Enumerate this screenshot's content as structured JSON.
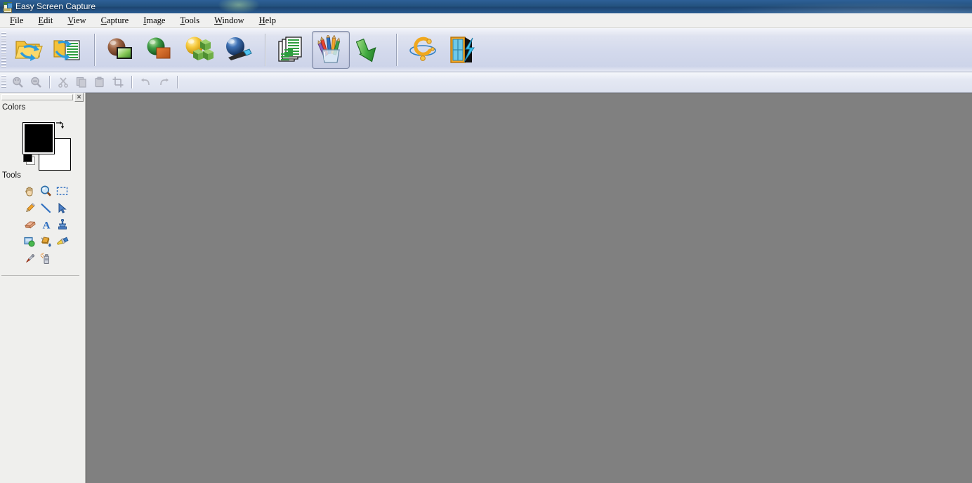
{
  "window": {
    "title": "Easy Screen Capture",
    "icon": "app-document-icon"
  },
  "menubar": {
    "items": [
      {
        "label": "File",
        "accel": "F",
        "name": "menu-file"
      },
      {
        "label": "Edit",
        "accel": "E",
        "name": "menu-edit"
      },
      {
        "label": "View",
        "accel": "V",
        "name": "menu-view"
      },
      {
        "label": "Capture",
        "accel": "C",
        "name": "menu-capture"
      },
      {
        "label": "Image",
        "accel": "I",
        "name": "menu-image"
      },
      {
        "label": "Tools",
        "accel": "T",
        "name": "menu-tools"
      },
      {
        "label": "Window",
        "accel": "W",
        "name": "menu-window"
      },
      {
        "label": "Help",
        "accel": "H",
        "name": "menu-help"
      }
    ]
  },
  "toolbar_main": {
    "buttons": [
      {
        "name": "open-file-button",
        "icon": "folder-open-arrow-icon",
        "active": false
      },
      {
        "name": "open-recent-button",
        "icon": "folder-document-refresh-icon",
        "active": false
      },
      {
        "name": "capture-region-button",
        "icon": "sphere-rectangle-icon",
        "active": false
      },
      {
        "name": "capture-object-button",
        "icon": "sphere-square-icon",
        "active": false
      },
      {
        "name": "capture-objects-button",
        "icon": "sphere-cubes-icon",
        "active": false
      },
      {
        "name": "capture-cursor-button",
        "icon": "sphere-wand-icon",
        "active": false
      },
      {
        "name": "capture-pages-button",
        "icon": "stacked-documents-icon",
        "active": false
      },
      {
        "name": "drawing-tools-button",
        "icon": "pencil-cup-icon",
        "active": true
      },
      {
        "name": "capture-scroll-button",
        "icon": "green-down-arrow-icon",
        "active": false
      },
      {
        "name": "settings-button",
        "icon": "orb-orbit-icon",
        "active": false
      },
      {
        "name": "exit-button",
        "icon": "door-exit-icon",
        "active": false
      }
    ],
    "separators_after": [
      1,
      5,
      8
    ]
  },
  "toolbar_sub": {
    "buttons": [
      {
        "name": "zoom-in-button",
        "icon": "zoom-in-icon",
        "enabled": false
      },
      {
        "name": "zoom-out-button",
        "icon": "zoom-out-icon",
        "enabled": false
      },
      {
        "name": "cut-button",
        "icon": "scissors-icon",
        "enabled": false
      },
      {
        "name": "copy-button",
        "icon": "copy-icon",
        "enabled": false
      },
      {
        "name": "paste-button",
        "icon": "paste-icon",
        "enabled": false
      },
      {
        "name": "crop-button",
        "icon": "crop-icon",
        "enabled": false
      },
      {
        "name": "undo-button",
        "icon": "undo-arrow-icon",
        "enabled": false
      },
      {
        "name": "redo-button",
        "icon": "redo-arrow-icon",
        "enabled": false
      }
    ],
    "separators_after": [
      1,
      5,
      7
    ]
  },
  "sidebar": {
    "close_label": "✕",
    "colors_panel": {
      "title": "Colors",
      "foreground": "#000000",
      "background": "#ffffff",
      "swap_icon": "swap-arrows-icon",
      "reset_icon": "reset-colors-icon"
    },
    "tools_panel": {
      "title": "Tools",
      "tools": [
        {
          "name": "tool-hand",
          "icon": "hand-icon"
        },
        {
          "name": "tool-zoom",
          "icon": "magnifier-icon"
        },
        {
          "name": "tool-select",
          "icon": "marquee-select-icon"
        },
        {
          "name": "tool-pencil",
          "icon": "pencil-icon"
        },
        {
          "name": "tool-line",
          "icon": "line-icon"
        },
        {
          "name": "tool-pointer",
          "icon": "cursor-arrow-icon"
        },
        {
          "name": "tool-eraser",
          "icon": "eraser-icon"
        },
        {
          "name": "tool-text",
          "icon": "text-a-icon"
        },
        {
          "name": "tool-stamp",
          "icon": "clone-stamp-icon"
        },
        {
          "name": "tool-shape",
          "icon": "shape-image-icon"
        },
        {
          "name": "tool-fill",
          "icon": "paint-bucket-icon"
        },
        {
          "name": "tool-brush",
          "icon": "paintbrush-icon"
        },
        {
          "name": "tool-eyedropper",
          "icon": "eyedropper-icon"
        },
        {
          "name": "tool-spray",
          "icon": "spray-can-icon"
        }
      ]
    }
  },
  "canvas": {
    "background_color": "#808080",
    "content": ""
  }
}
